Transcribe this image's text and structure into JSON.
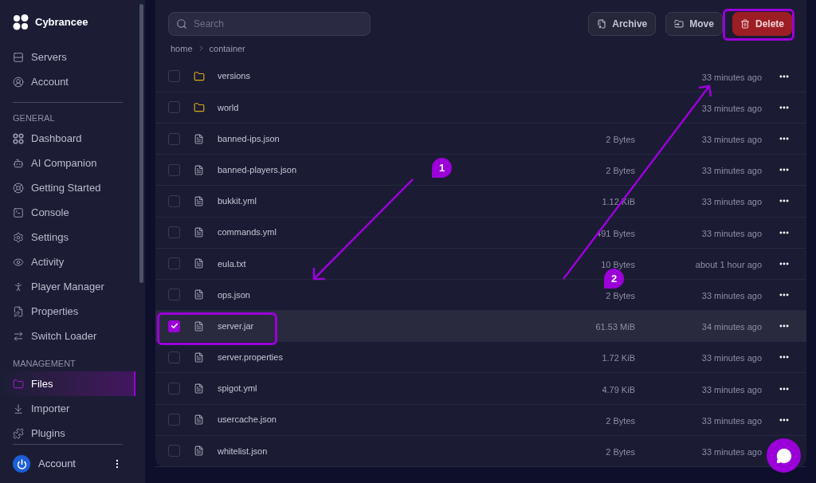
{
  "sidebar": {
    "brand": "Cybrancee",
    "top_items": [
      {
        "label": "Servers",
        "selected": false
      },
      {
        "label": "Account",
        "selected": false
      }
    ],
    "sections": [
      {
        "heading": "GENERAL",
        "items": [
          {
            "label": "Dashboard",
            "selected": false
          },
          {
            "label": "AI Companion",
            "selected": false
          },
          {
            "label": "Getting Started",
            "selected": false
          },
          {
            "label": "Console",
            "selected": false
          },
          {
            "label": "Settings",
            "selected": false
          },
          {
            "label": "Activity",
            "selected": false
          },
          {
            "label": "Player Manager",
            "selected": false
          },
          {
            "label": "Properties",
            "selected": false
          },
          {
            "label": "Switch Loader",
            "selected": false
          }
        ]
      },
      {
        "heading": "MANAGEMENT",
        "items": [
          {
            "label": "Files",
            "selected": true
          },
          {
            "label": "Importer",
            "selected": false
          },
          {
            "label": "Plugins",
            "selected": false
          }
        ]
      }
    ],
    "footer": {
      "label": "Account"
    }
  },
  "search": {
    "placeholder": "Search"
  },
  "toolbar": [
    {
      "label": "Archive",
      "kind": "neutral"
    },
    {
      "label": "Move",
      "kind": "neutral"
    },
    {
      "label": "Delete",
      "kind": "danger"
    }
  ],
  "breadcrumb": [
    "home",
    "container"
  ],
  "files": [
    {
      "name": "versions",
      "kind": "folder",
      "modified": "33 minutes ago",
      "checked": false,
      "selected": false
    },
    {
      "name": "world",
      "kind": "folder",
      "modified": "33 minutes ago",
      "checked": false,
      "selected": false
    },
    {
      "name": "banned-ips.json",
      "kind": "file",
      "size": "2 Bytes",
      "modified": "33 minutes ago",
      "checked": false,
      "selected": false
    },
    {
      "name": "banned-players.json",
      "kind": "file",
      "size": "2 Bytes",
      "modified": "33 minutes ago",
      "checked": false,
      "selected": false
    },
    {
      "name": "bukkit.yml",
      "kind": "file",
      "size": "1.12 KiB",
      "modified": "33 minutes ago",
      "checked": false,
      "selected": false
    },
    {
      "name": "commands.yml",
      "kind": "file",
      "size": "491 Bytes",
      "modified": "33 minutes ago",
      "checked": false,
      "selected": false
    },
    {
      "name": "eula.txt",
      "kind": "file",
      "size": "10 Bytes",
      "modified": "about 1 hour ago",
      "checked": false,
      "selected": false
    },
    {
      "name": "ops.json",
      "kind": "file",
      "size": "2 Bytes",
      "modified": "33 minutes ago",
      "checked": false,
      "selected": false
    },
    {
      "name": "server.jar",
      "kind": "file",
      "size": "61.53 MiB",
      "modified": "34 minutes ago",
      "checked": true,
      "selected": true
    },
    {
      "name": "server.properties",
      "kind": "file",
      "size": "1.72 KiB",
      "modified": "33 minutes ago",
      "checked": false,
      "selected": false
    },
    {
      "name": "spigot.yml",
      "kind": "file",
      "size": "4.79 KiB",
      "modified": "33 minutes ago",
      "checked": false,
      "selected": false
    },
    {
      "name": "usercache.json",
      "kind": "file",
      "size": "2 Bytes",
      "modified": "33 minutes ago",
      "checked": false,
      "selected": false
    },
    {
      "name": "whitelist.json",
      "kind": "file",
      "size": "2 Bytes",
      "modified": "33 minutes ago",
      "checked": false,
      "selected": false
    }
  ],
  "callouts": [
    {
      "label": "1"
    },
    {
      "label": "2"
    }
  ]
}
